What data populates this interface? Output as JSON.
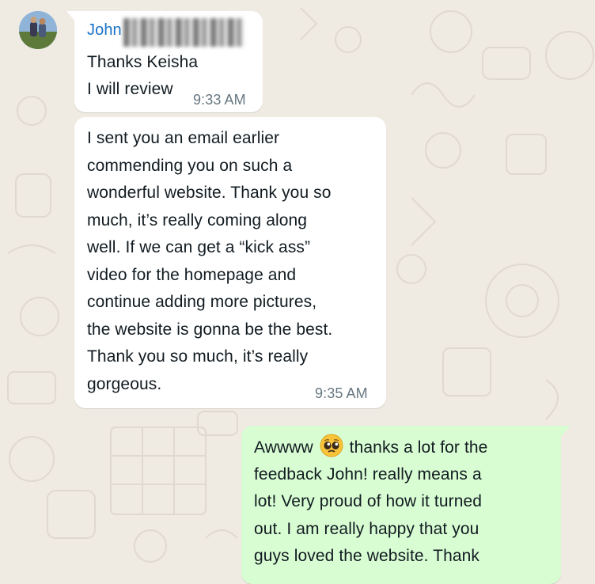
{
  "messages": [
    {
      "sender": "John",
      "lines": [
        "Thanks Keisha",
        "I will review"
      ],
      "time": "9:33 AM",
      "direction": "incoming"
    },
    {
      "lines": [
        "I sent you an email earlier",
        "commending you on such a",
        "wonderful website. Thank you so",
        "much, it’s really coming along",
        "well. If we can get a “kick ass”",
        "video for the homepage and",
        "continue adding more pictures,",
        "the website is gonna be the best.",
        "Thank you so much, it’s really",
        "gorgeous."
      ],
      "time": "9:35 AM",
      "direction": "incoming"
    },
    {
      "lines_before_emoji": "Awwww",
      "emoji": "pleading-face-emoji",
      "lines_after_emoji": "thanks a lot for the",
      "lines": [
        "feedback John! really means a",
        "lot! Very proud of how it turned",
        "out. I am really happy that you",
        "guys loved the website. Thank"
      ],
      "direction": "outgoing"
    }
  ],
  "colors": {
    "wallpaper": "#efeae2",
    "incoming_bubble": "#ffffff",
    "outgoing_bubble": "#d9fdd3",
    "sender_name": "#1a72c8",
    "timestamp": "#667781"
  }
}
